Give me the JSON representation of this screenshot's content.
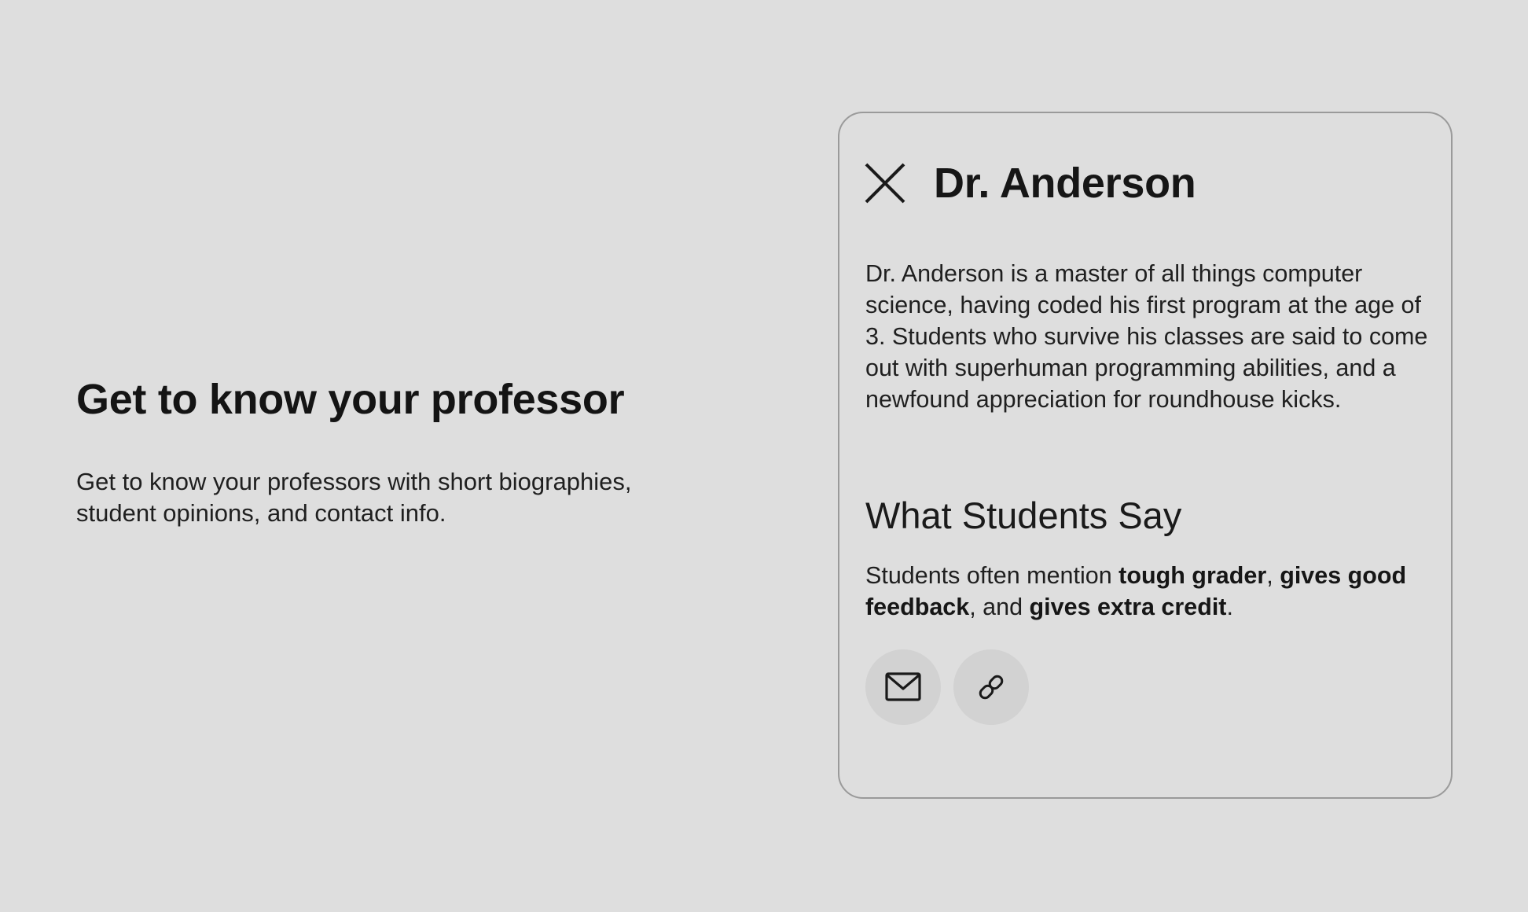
{
  "intro": {
    "title": "Get to know your professor",
    "description": "Get to know your professors with short biographies, student opinions, and contact info."
  },
  "card": {
    "close_icon": "close-icon",
    "name": "Dr. Anderson",
    "bio": "Dr. Anderson is a master of all things computer science, having coded his first program at the age of 3. Students who survive his classes are said to come out with superhuman programming abilities, and a newfound appreciation for roundhouse kicks.",
    "opinions_heading": "What Students Say",
    "opinions": {
      "prefix": "Students often mention ",
      "tag1": "tough grader",
      "sep1": ", ",
      "tag2": "gives good feedback",
      "sep2": ", and ",
      "tag3": "gives extra credit",
      "suffix": "."
    },
    "actions": [
      {
        "icon": "mail-icon"
      },
      {
        "icon": "link-icon"
      }
    ]
  },
  "colors": {
    "background": "#dedede",
    "card_border": "#9a9a9a",
    "button_bg": "#d2d2d2",
    "text": "#1c1c1c"
  }
}
